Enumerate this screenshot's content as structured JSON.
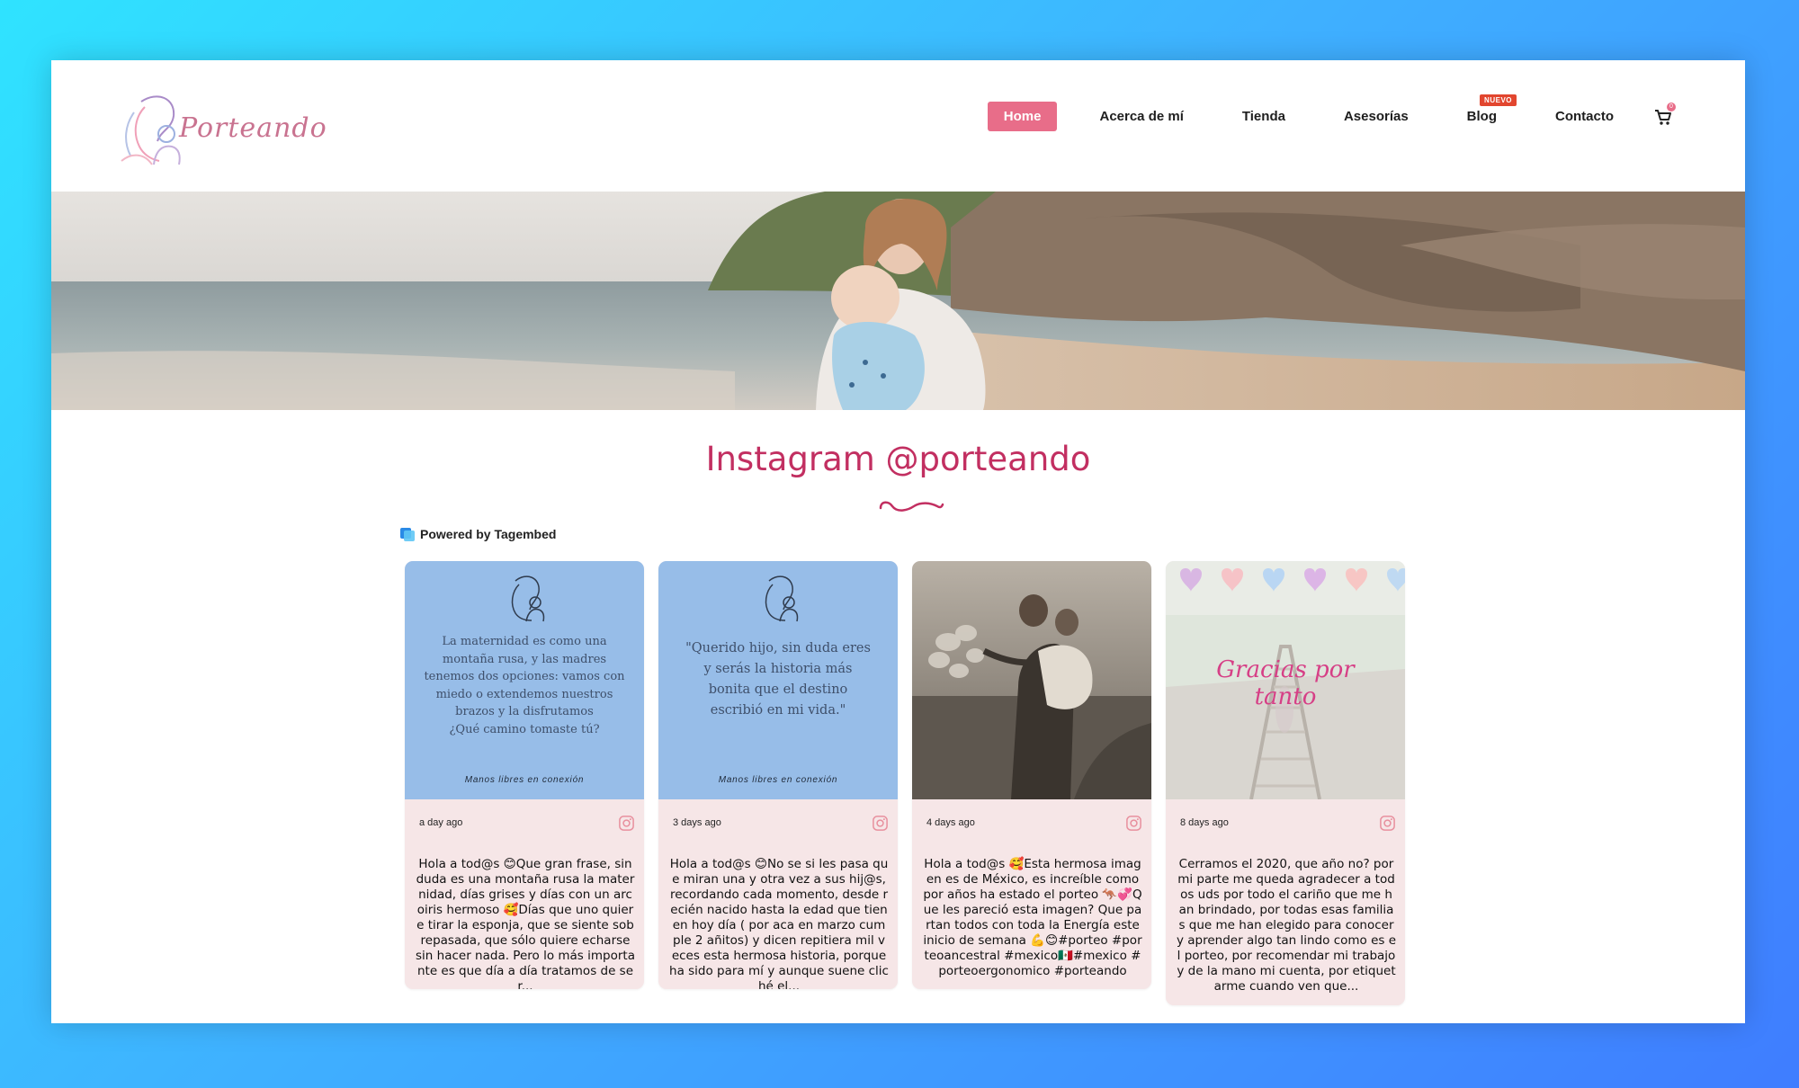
{
  "brand": {
    "name": "Porteando"
  },
  "nav": {
    "items": [
      {
        "label": "Home",
        "active": true
      },
      {
        "label": "Acerca de mí"
      },
      {
        "label": "Tienda"
      },
      {
        "label": "Asesorías"
      },
      {
        "label": "Blog",
        "badge": "NUEVO"
      },
      {
        "label": "Contacto"
      }
    ],
    "cart_count": "0"
  },
  "instagram": {
    "title": "Instagram @porteando",
    "powered_by": "Powered by Tagembed",
    "posts": [
      {
        "image_type": "quote",
        "quote": "La maternidad es como una montaña rusa, y las madres tenemos dos opciones: vamos con miedo o extendemos nuestros brazos y la disfrutamos\n¿Qué camino tomaste tú?",
        "signature": "Manos libres en conexión",
        "time": "a day ago",
        "caption": "Hola a tod@s 😊Que gran frase, sin duda es una montaña rusa la maternidad, días grises y días con un arcoiris hermoso 🥰Días que uno quiere tirar la esponja, que se siente sobrepasada, que sólo quiere echarse sin hacer nada. Pero lo más importante es que día a día tratamos de ser..."
      },
      {
        "image_type": "quote",
        "quote": "\"Querido hijo, sin duda eres y serás la historia más bonita que el destino escribió en mi vida.\"",
        "signature": "Manos libres en conexión",
        "time": "3 days ago",
        "caption": "Hola a tod@s 😊No se si les pasa que miran una y otra vez a sus hij@s, recordando cada momento, desde recién nacido hasta la edad que tienen hoy día ( por aca en marzo cumple 2 añitos) y dicen repitiera mil veces esta hermosa historia, porque ha sido para mí y aunque suene cliché el..."
      },
      {
        "image_type": "photo",
        "time": "4 days ago",
        "caption": "Hola a tod@s 🥰Esta hermosa imagen es de México, es increíble como por años ha estado el porteo 🦘💞Que les pareció esta imagen? Que partan todos con toda la Energía este inicio de semana 💪😊#porteo #porteoancestral #mexico🇲🇽#mexico #porteoergonomico #porteando"
      },
      {
        "image_type": "thanks",
        "overlay": "Gracias por tanto",
        "time": "8 days ago",
        "caption": "Cerramos el 2020, que año no? por mi parte me queda agradecer a todos uds por todo el cariño que me han brindado, por todas esas familias que me han elegido para conocer y aprender algo tan lindo como es el porteo, por recomendar mi trabajo y de la mano mi cuenta, por etiquetarme cuando ven que..."
      }
    ]
  },
  "colors": {
    "accent": "#e86d89",
    "title": "#c22f61",
    "card_bg": "#f6e6e7",
    "quote_bg": "#97bde8"
  }
}
